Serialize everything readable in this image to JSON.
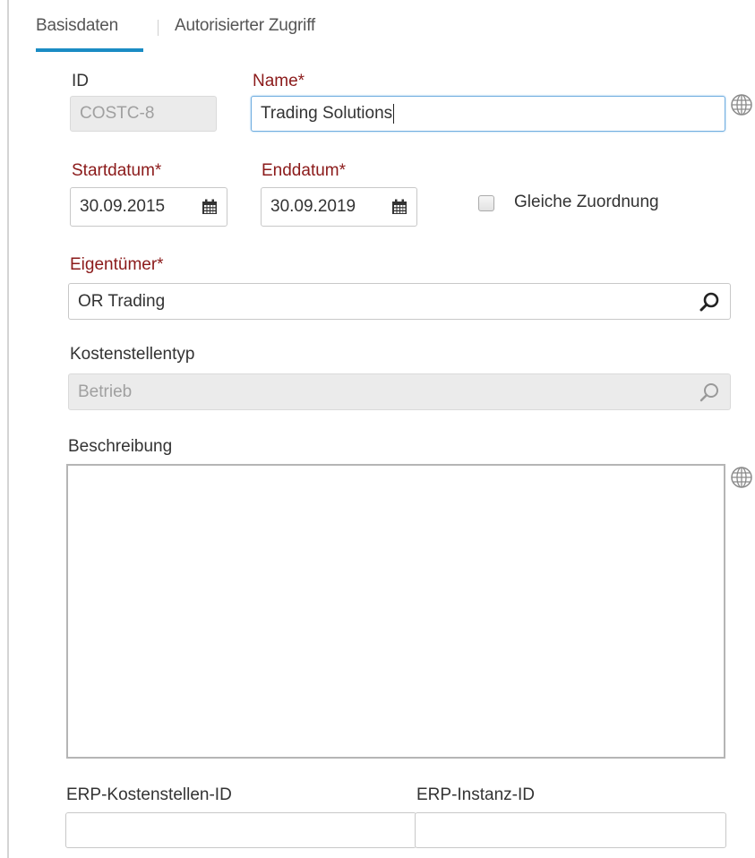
{
  "tabs": {
    "basisdaten": "Basisdaten",
    "autorisierter_zugriff": "Autorisierter Zugriff"
  },
  "fields": {
    "id": {
      "label": "ID",
      "value": "COSTC-8"
    },
    "name": {
      "label": "Name*",
      "value": "Trading Solutions"
    },
    "startdatum": {
      "label": "Startdatum*",
      "value": "30.09.2015"
    },
    "enddatum": {
      "label": "Enddatum*",
      "value": "30.09.2019"
    },
    "gleiche_zuordnung": {
      "label": "Gleiche Zuordnung",
      "checked": false
    },
    "eigentuemer": {
      "label": "Eigentümer*",
      "value": "OR Trading"
    },
    "kostenstellentyp": {
      "label": "Kostenstellentyp",
      "value": "Betrieb"
    },
    "beschreibung": {
      "label": "Beschreibung",
      "value": ""
    },
    "erp_kostenstellen_id": {
      "label": "ERP-Kostenstellen-ID",
      "value": ""
    },
    "erp_instanz_id": {
      "label": "ERP-Instanz-ID",
      "value": ""
    }
  },
  "colors": {
    "required_label": "#8b1a1a",
    "tab_underline": "#1a8cc4",
    "focus_border": "#70aee0",
    "disabled_bg": "#ebebeb"
  },
  "icons": {
    "calendar": "calendar-icon",
    "search": "search-icon",
    "translate": "globe-icon"
  }
}
